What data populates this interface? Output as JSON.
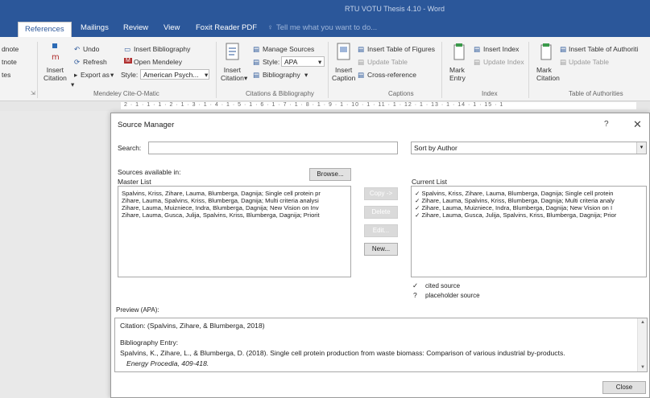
{
  "window": {
    "title": "RTU VOTU Thesis 4.10 - Word"
  },
  "ribbon_tabs": [
    {
      "label": "References",
      "active": true
    },
    {
      "label": "Mailings"
    },
    {
      "label": "Review"
    },
    {
      "label": "View"
    },
    {
      "label": "Foxit Reader PDF"
    },
    {
      "label": "Tell me what you want to do..."
    }
  ],
  "ribbon": {
    "footnotes": {
      "label1": "dnote",
      "label2": "tnote",
      "label3": "tes"
    },
    "mendeley": {
      "undo": "Undo",
      "refresh": "Refresh",
      "insert_citation": "Insert\nCitation",
      "insert_bibliography": "Insert Bibliography",
      "open_mendeley": "Open Mendeley",
      "export_as": "Export as",
      "style_label": "Style:",
      "style_value": "American Psych...",
      "group_label": "Mendeley Cite-O-Matic"
    },
    "citations": {
      "insert_citation": "Insert\nCitation",
      "manage_sources": "Manage Sources",
      "style_label": "Style:",
      "style_value": "APA",
      "bibliography": "Bibliography",
      "group_label": "Citations & Bibliography"
    },
    "captions": {
      "insert_caption": "Insert\nCaption",
      "insert_table_of_figures": "Insert Table of Figures",
      "update_table": "Update Table",
      "cross_reference": "Cross-reference",
      "group_label": "Captions"
    },
    "index": {
      "mark_entry": "Mark\nEntry",
      "insert_index": "Insert Index",
      "update_index": "Update Index",
      "group_label": "Index"
    },
    "authorities": {
      "mark_citation": "Mark\nCitation",
      "insert_table": "Insert Table of Authoriti",
      "update_table": "Update Table",
      "group_label": "Table of Authorities"
    }
  },
  "ruler": {
    "text": "2 · 1 · 1 · 1 · 2 · 1 · 3 · 1 · 4 · 1 · 5 · 1 · 6 · 1 · 7 · 1 · 8 · 1 · 9 · 1 · 10 · 1 · 11 · 1 · 12 · 1 · 13 · 1 · 14 · 1 · 15 · 1"
  },
  "dialog": {
    "title": "Source Manager",
    "help": "?",
    "close": "✕",
    "search_label": "Search:",
    "search_value": "",
    "sort_value": "Sort by Author",
    "sources_available": "Sources available in:",
    "master_list_label": "Master List",
    "browse": "Browse...",
    "current_list_label": "Current List",
    "copy": "Copy ->",
    "delete": "Delete",
    "edit": "Edit...",
    "new": "New...",
    "master_list": [
      "Spalvins, Kriss, Zihare, Lauma, Blumberga, Dagnija; Single cell protein pr",
      "Zihare, Lauma, Spalvins, Kriss, Blumberga, Dagnija; Multi criteria analysi",
      "Zihare, Lauma, Muizniece, Indra, Blumberga, Dagnija; New Vision on Inv",
      "Zihare, Lauma, Gusca, Julija, Spalvins, Kriss, Blumberga, Dagnija; Priorit"
    ],
    "current_list": [
      "✓ Spalvins, Kriss, Zihare, Lauma, Blumberga, Dagnija; Single cell protein",
      "✓ Zihare, Lauma, Spalvins, Kriss, Blumberga, Dagnija; Multi criteria analy",
      "✓ Zihare, Lauma, Muizniece, Indra, Blumberga, Dagnija; New Vision on I",
      "✓ Zihare, Lauma, Gusca, Julija, Spalvins, Kriss, Blumberga, Dagnija; Prior"
    ],
    "legend_cited_mark": "✓",
    "legend_cited": "cited source",
    "legend_placeholder_mark": "?",
    "legend_placeholder": "placeholder source",
    "preview_label": "Preview (APA):",
    "preview_citation": "Citation:  (Spalvins, Zihare, & Blumberga, 2018)",
    "preview_bib_heading": "Bibliography Entry:",
    "preview_bib_line1": "Spalvins, K., Zihare, L., & Blumberga, D. (2018). Single cell protein production from waste biomass: Comparison of various industrial by-products.",
    "preview_bib_line2": "Energy Procedia, 409-418.",
    "close_button": "Close"
  }
}
